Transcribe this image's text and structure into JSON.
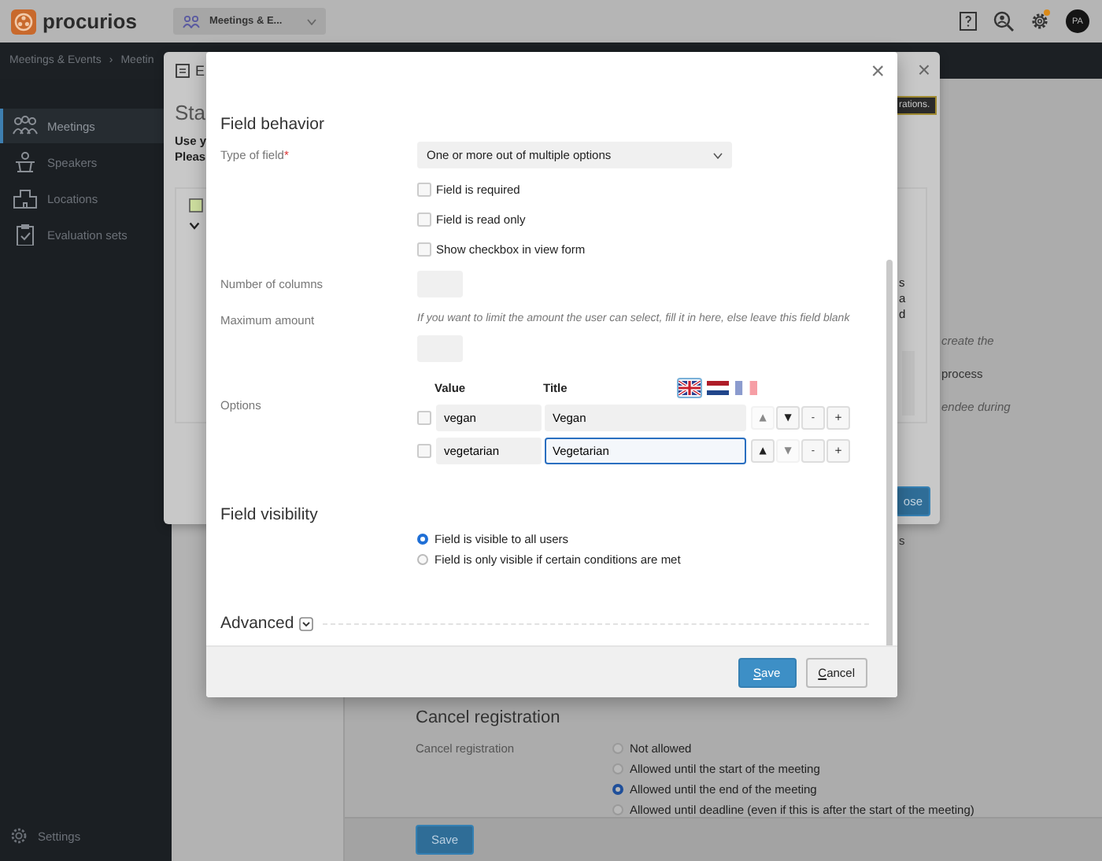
{
  "topbar": {
    "brand": "procurios",
    "module": "Meetings & E...",
    "avatar": "PA",
    "notification_dot": true
  },
  "breadcrumb": {
    "items": [
      "Meetings & Events",
      "Meetin"
    ],
    "separator": "›"
  },
  "sidebar": {
    "items": [
      {
        "kind": "people",
        "label": "Meetings",
        "selected": true
      },
      {
        "kind": "podium",
        "label": "Speakers",
        "selected": false
      },
      {
        "kind": "building",
        "label": "Locations",
        "selected": false
      },
      {
        "kind": "clipboard",
        "label": "Evaluation sets",
        "selected": false
      }
    ],
    "footer": "Settings"
  },
  "page": {
    "fragments": [
      {
        "text": "create the",
        "italic": true
      },
      {
        "text": "process",
        "italic": false
      },
      {
        "text": "endee during",
        "italic": true
      }
    ],
    "side_text": "s",
    "cancel_registration": {
      "heading": "Cancel registration",
      "label": "Cancel registration",
      "choices": [
        {
          "label": "Not allowed",
          "selected": false
        },
        {
          "label": "Allowed until the start of the meeting",
          "selected": false
        },
        {
          "label": "Allowed until the end of the meeting",
          "selected": true
        },
        {
          "label": "Allowed until deadline (even if this is after the start of the meeting)",
          "selected": false
        }
      ]
    },
    "save": "Save"
  },
  "back_dialog": {
    "close": "×",
    "title": "E",
    "heading": "Sta",
    "lines": [
      "Use y",
      "Pleas"
    ],
    "tooltip": "rations.",
    "side_lines": [
      "s",
      "a",
      "d"
    ],
    "button": "ose"
  },
  "dialog": {
    "close": "×",
    "behavior": {
      "heading": "Field behavior",
      "type_label": "Type of field",
      "required_mark": "*",
      "type_value": "One or more out of multiple options",
      "flags": [
        {
          "label": "Field is required",
          "checked": false
        },
        {
          "label": "Field is read only",
          "checked": false
        },
        {
          "label": "Show checkbox in view form",
          "checked": false
        }
      ],
      "columns_label": "Number of columns",
      "max_label": "Maximum amount",
      "max_hint": "If you want to limit the amount the user can select, fill it in here, else leave this field blank",
      "options_label": "Options",
      "value_heading": "Value",
      "title_heading": "Title",
      "languages": [
        {
          "kind": "gb",
          "selected": true,
          "translated": true
        },
        {
          "kind": "nl",
          "selected": false,
          "translated": true
        },
        {
          "kind": "fr",
          "selected": false,
          "translated": false
        }
      ],
      "options": [
        {
          "checked": false,
          "value": "vegan",
          "title": "Vegan",
          "focused": false,
          "buttons": [
            {
              "label": "▲",
              "disabled": true
            },
            {
              "label": "▼",
              "disabled": false
            },
            {
              "label": "-",
              "disabled": false
            },
            {
              "label": "+",
              "disabled": false
            }
          ]
        },
        {
          "checked": false,
          "value": "vegetarian",
          "title": "Vegetarian",
          "focused": true,
          "buttons": [
            {
              "label": "▲",
              "disabled": false
            },
            {
              "label": "▼",
              "disabled": true
            },
            {
              "label": "-",
              "disabled": false
            },
            {
              "label": "+",
              "disabled": false
            }
          ]
        }
      ]
    },
    "visibility": {
      "heading": "Field visibility",
      "choices": [
        {
          "label": "Field is visible to all users",
          "selected": true
        },
        {
          "label": "Field is only visible if certain conditions are met",
          "selected": false
        }
      ]
    },
    "advanced": {
      "heading": "Advanced",
      "expanded": false
    },
    "footer": {
      "save": "Save",
      "cancel": "Cancel"
    }
  }
}
